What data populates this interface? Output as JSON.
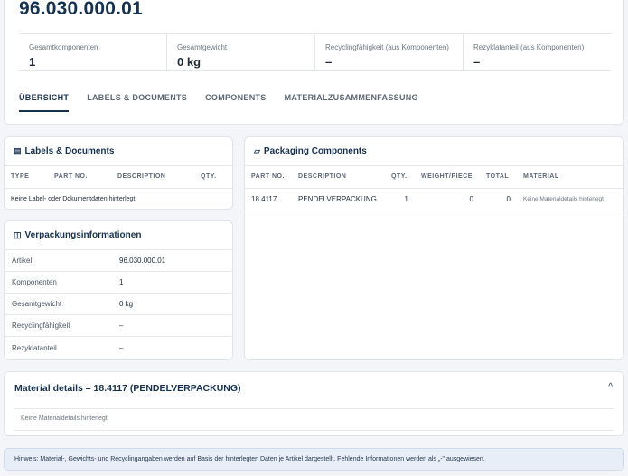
{
  "header": {
    "title": "96.030.000.01",
    "stats": [
      {
        "label": "Gesamtkomponenten",
        "value": "1"
      },
      {
        "label": "Gesamtgewicht",
        "value": "0 kg"
      },
      {
        "label": "Recyclingfähigkeit (aus Komponenten)",
        "value": "–"
      },
      {
        "label": "Rezyklatanteil (aus Komponenten)",
        "value": "–"
      }
    ],
    "tabs": [
      "ÜBERSICHT",
      "LABELS & DOCUMENTS",
      "COMPONENTS",
      "MATERIALZUSAMMENFASSUNG"
    ]
  },
  "labels": {
    "title": "Labels & Documents",
    "icon": "document-icon",
    "columns": [
      "TYPE",
      "PART NO.",
      "DESCRIPTION",
      "QTY."
    ],
    "empty": "Keine Label- oder Dokumentdaten hinterlegt."
  },
  "verpackung": {
    "title": "Verpackungsinformationen",
    "icon": "columns-icon",
    "rows": [
      {
        "key": "Artikel",
        "value": "96.030.000.01"
      },
      {
        "key": "Komponenten",
        "value": "1"
      },
      {
        "key": "Gesamtgewicht",
        "value": "0 kg"
      },
      {
        "key": "Recyclingfähigkeit",
        "value": "–"
      },
      {
        "key": "Rezyklatanteil",
        "value": "–"
      }
    ]
  },
  "components": {
    "title": "Packaging Components",
    "icon": "box-icon",
    "columns": [
      "PART NO.",
      "DESCRIPTION",
      "QTY.",
      "WEIGHT/PIECE",
      "TOTAL",
      "MATERIAL"
    ],
    "rows": [
      {
        "part": "18.4117",
        "desc": "PENDELVERPACKUNG",
        "qty": "1",
        "weight": "0",
        "total": "0",
        "material": "Keine Materialdetails hinterlegt"
      }
    ]
  },
  "material": {
    "title": "Material details – 18.4117 (PENDELVERPACKUNG)",
    "chevron": "^",
    "empty": "Keine Materialdetails hinterlegt."
  },
  "hint": "Hinweis: Material-, Gewichts- und Recyclingangaben werden auf Basis der hinterlegten Daten je Artikel dargestellt. Fehlende Informationen werden als „-\" ausgewiesen."
}
